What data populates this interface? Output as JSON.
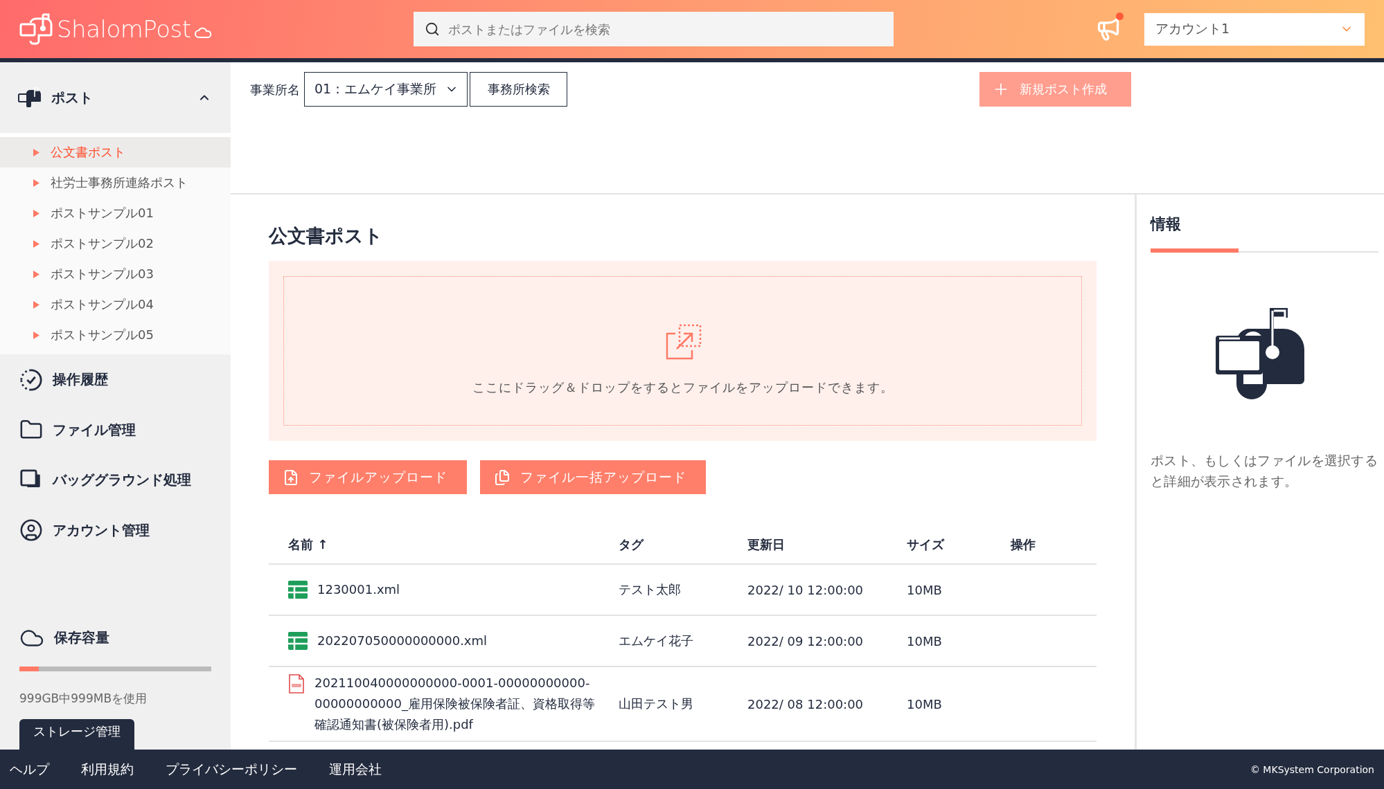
{
  "header": {
    "logo": "ShalomPost",
    "search": {
      "placeholder": "ポストまたはファイルを検索"
    },
    "notification": {
      "unread": true
    },
    "account": {
      "value": "アカウント1"
    }
  },
  "sidebar": {
    "post_group": {
      "label": "ポスト",
      "expanded": true,
      "items": [
        {
          "label": "公文書ポスト",
          "selected": true
        },
        {
          "label": "社労士事務所連絡ポスト",
          "selected": false
        },
        {
          "label": "ポストサンプル01",
          "selected": false
        },
        {
          "label": "ポストサンプル02",
          "selected": false
        },
        {
          "label": "ポストサンプル03",
          "selected": false
        },
        {
          "label": "ポストサンプル04",
          "selected": false
        },
        {
          "label": "ポストサンプル05",
          "selected": false
        }
      ]
    },
    "nav": [
      {
        "label": "操作履歴",
        "kind": "history"
      },
      {
        "label": "ファイル管理",
        "kind": "folder"
      },
      {
        "label": "バッググラウンド処理",
        "kind": "layers"
      },
      {
        "label": "アカウント管理",
        "kind": "account"
      }
    ],
    "storage": {
      "title": "保存容量",
      "level": 0.1,
      "usage": "999GB中999MBを使用",
      "button": "ストレージ管理"
    }
  },
  "toolbar": {
    "office_label": "事業所名",
    "office_select": "01：エムケイ事業所",
    "office_search": "事務所検索",
    "new_post": "新規ポスト作成"
  },
  "main": {
    "title": "公文書ポスト",
    "dropzone": "ここにドラッグ＆ドロップをするとファイルをアップロードできます。",
    "buttons": [
      {
        "label": "ファイルアップロード",
        "kind": "single"
      },
      {
        "label": "ファイル一括アップロード",
        "kind": "bulk"
      }
    ],
    "table": {
      "columns": [
        {
          "label": "名前",
          "sort": "↑"
        },
        {
          "label": "タグ"
        },
        {
          "label": "更新日"
        },
        {
          "label": "サイズ"
        },
        {
          "label": "操作"
        }
      ],
      "rows": [
        {
          "kind": "sheet",
          "name": "1230001.xml",
          "tag": "テスト太郎",
          "date": "2022/ 10 12:00:00",
          "size": "10MB"
        },
        {
          "kind": "sheet",
          "name": "202207050000000000.xml",
          "tag": "エムケイ花子",
          "date": "2022/ 09 12:00:00",
          "size": "10MB"
        },
        {
          "kind": "pdf",
          "name": "202110040000000000-0001-00000000000-00000000000_雇用保険被保険者証、資格取得等確認通知書(被保険者用).pdf",
          "tag": "山田テスト男",
          "date": "2022/ 08 12:00:00",
          "size": "10MB"
        }
      ]
    }
  },
  "info": {
    "title": "情報",
    "message": "ポスト、もしくはファイルを選択すると詳細が表示されます。"
  },
  "footer": {
    "links": [
      "ヘルプ",
      "利用規約",
      "プライバシーポリシー",
      "運用会社"
    ],
    "copyright": "© MKSystem Corporation"
  }
}
